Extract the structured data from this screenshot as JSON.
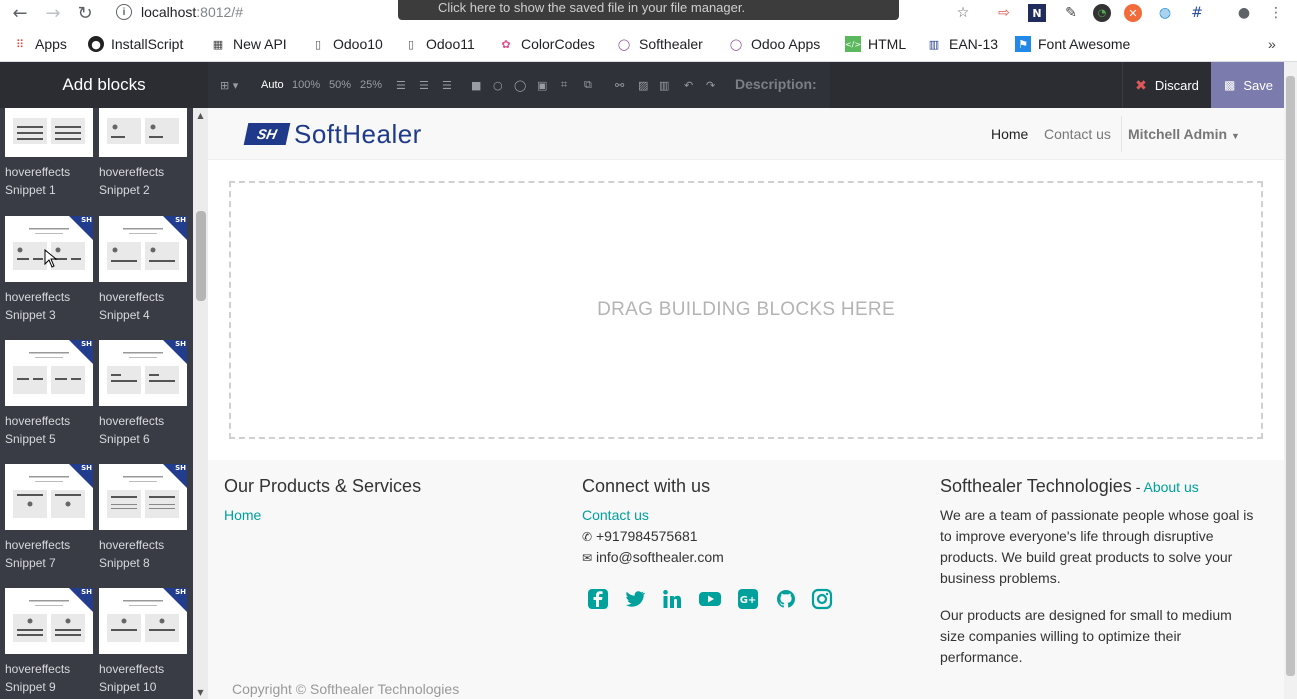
{
  "browser": {
    "url_host": "localhost",
    "url_rest": ":8012/#",
    "toast": "Click here to show the saved file in your file manager.",
    "bookmarks": [
      {
        "label": "Apps"
      },
      {
        "label": "InstallScript"
      },
      {
        "label": "New API"
      },
      {
        "label": "Odoo10"
      },
      {
        "label": "Odoo11"
      },
      {
        "label": "ColorCodes"
      },
      {
        "label": "Softhealer"
      },
      {
        "label": "Odoo Apps"
      },
      {
        "label": "HTML"
      },
      {
        "label": "EAN-13"
      },
      {
        "label": "Font Awesome"
      }
    ]
  },
  "editor": {
    "panel_title": "Add blocks",
    "toolbar": {
      "auto": "Auto",
      "z100": "100%",
      "z50": "50%",
      "z25": "25%",
      "description": "Description:"
    },
    "discard_label": "Discard",
    "save_label": "Save"
  },
  "snippets": [
    {
      "line1": "hovereffects",
      "line2": "Snippet 1"
    },
    {
      "line1": "hovereffects",
      "line2": "Snippet 2"
    },
    {
      "line1": "hovereffects",
      "line2": "Snippet 3"
    },
    {
      "line1": "hovereffects",
      "line2": "Snippet 4"
    },
    {
      "line1": "hovereffects",
      "line2": "Snippet 5"
    },
    {
      "line1": "hovereffects",
      "line2": "Snippet 6"
    },
    {
      "line1": "hovereffects",
      "line2": "Snippet 7"
    },
    {
      "line1": "hovereffects",
      "line2": "Snippet 8"
    },
    {
      "line1": "hovereffects",
      "line2": "Snippet 9"
    },
    {
      "line1": "hovereffects",
      "line2": "Snippet 10"
    }
  ],
  "site": {
    "logo_mark": "SH",
    "logo_text": "SoftHealer",
    "nav": {
      "home": "Home",
      "contact": "Contact us",
      "user": "Mitchell Admin"
    },
    "drop_zone": "DRAG BUILDING BLOCKS HERE",
    "footer": {
      "col1_title": "Our Products & Services",
      "col1_link": "Home",
      "col2_title": "Connect with us",
      "col2_link": "Contact us",
      "phone": "+917984575681",
      "email": "info@softhealer.com",
      "col3_title": "Softhealer Technologies",
      "col3_sep": " - ",
      "col3_link": "About us",
      "para1": "We are a team of passionate people whose goal is to improve everyone's life through disruptive products. We build great products to solve your business problems.",
      "para2": "Our products are designed for small to medium size companies willing to optimize their performance.",
      "copyright": "Copyright © Softhealer Technologies"
    }
  },
  "colors": {
    "accent": "#00a09d",
    "save": "#7c7bad",
    "editor_bg": "#2b2d33",
    "brand": "#1f3a8a"
  }
}
